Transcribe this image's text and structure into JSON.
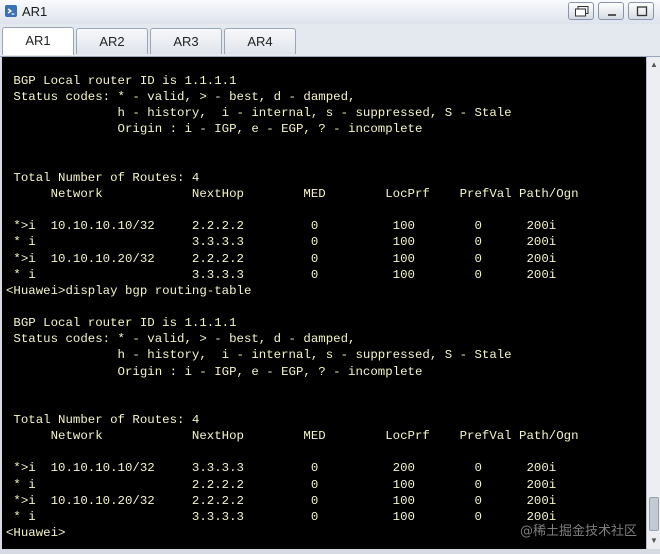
{
  "window": {
    "title": "AR1",
    "icon": "terminal-app-icon"
  },
  "tabs": [
    {
      "label": "AR1",
      "active": true
    },
    {
      "label": "AR2",
      "active": false
    },
    {
      "label": "AR3",
      "active": false
    },
    {
      "label": "AR4",
      "active": false
    }
  ],
  "terminal": {
    "lines": [
      " BGP Local router ID is 1.1.1.1",
      " Status codes: * - valid, > - best, d - damped,",
      "               h - history,  i - internal, s - suppressed, S - Stale",
      "               Origin : i - IGP, e - EGP, ? - incomplete",
      "",
      "",
      " Total Number of Routes: 4",
      "      Network            NextHop        MED        LocPrf    PrefVal Path/Ogn",
      "",
      " *>i  10.10.10.10/32     2.2.2.2         0          100        0      200i",
      " * i                     3.3.3.3         0          100        0      200i",
      " *>i  10.10.10.20/32     2.2.2.2         0          100        0      200i",
      " * i                     3.3.3.3         0          100        0      200i",
      "<Huawei>display bgp routing-table",
      "",
      " BGP Local router ID is 1.1.1.1",
      " Status codes: * - valid, > - best, d - damped,",
      "               h - history,  i - internal, s - suppressed, S - Stale",
      "               Origin : i - IGP, e - EGP, ? - incomplete",
      "",
      "",
      " Total Number of Routes: 4",
      "      Network            NextHop        MED        LocPrf    PrefVal Path/Ogn",
      "",
      " *>i  10.10.10.10/32     3.3.3.3         0          200        0      200i",
      " * i                     2.2.2.2         0          100        0      200i",
      " *>i  10.10.10.20/32     2.2.2.2         0          100        0      200i",
      " * i                     3.3.3.3         0          100        0      200i",
      "<Huawei>"
    ]
  },
  "watermark": "@稀土掘金技术社区",
  "colors": {
    "terminal_bg": "#000000",
    "terminal_fg": "#f5f5c8"
  }
}
